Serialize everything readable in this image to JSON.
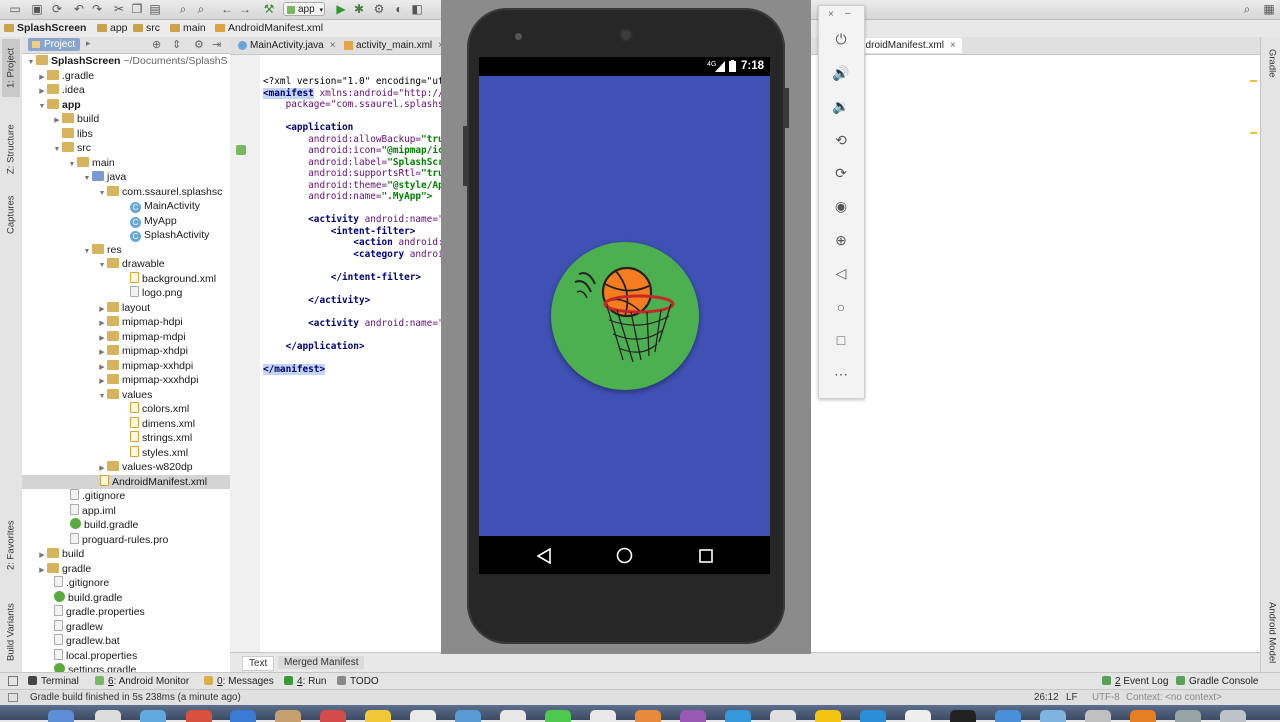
{
  "toolbar": {
    "run_config": "app"
  },
  "breadcrumb": [
    "SplashScreen",
    "app",
    "src",
    "main",
    "AndroidManifest.xml"
  ],
  "left_stripe": {
    "project": "1: Project",
    "structure": "Z: Structure",
    "captures": "Captures",
    "favorites": "2: Favorites",
    "build_variants": "Build Variants"
  },
  "right_stripe": {
    "gradle": "Gradle",
    "android_model": "Android Model"
  },
  "project_panel": {
    "tab": "Project",
    "root_name": "SplashScreen",
    "root_path": "~/Documents/SplashS",
    "items": [
      ".gradle",
      ".idea",
      "app",
      "build",
      "libs",
      "src",
      "main",
      "java",
      "com.ssaurel.splashsc",
      "MainActivity",
      "MyApp",
      "SplashActivity",
      "res",
      "drawable",
      "background.xml",
      "logo.png",
      "layout",
      "mipmap-hdpi",
      "mipmap-mdpi",
      "mipmap-xhdpi",
      "mipmap-xxhdpi",
      "mipmap-xxxhdpi",
      "values",
      "colors.xml",
      "dimens.xml",
      "strings.xml",
      "styles.xml",
      "values-w820dp",
      "AndroidManifest.xml",
      ".gitignore",
      "app.iml",
      "build.gradle",
      "proguard-rules.pro",
      "build",
      "gradle",
      ".gitignore",
      "build.gradle",
      "gradle.properties",
      "gradlew",
      "gradlew.bat",
      "local.properties",
      "settings.gradle"
    ]
  },
  "editor_tabs": {
    "tab1": "MainActivity.java",
    "tab2": "activity_main.xml",
    "tab3": "ndroidManifest.xml"
  },
  "code": {
    "l1a": "<?xml version=\"1.0\" encoding=\"utf-",
    "l2a": "<manifest",
    "l2b": " xmlns:android=\"http://sc",
    "l3": "    package=\"com.ssaurel.splashsc",
    "l5": "    <application",
    "l6a": "        android:allowBackup=",
    "l6b": "\"true",
    "l7a": "        android:icon=",
    "l7b": "\"@mipmap/ic_",
    "l8a": "        android:label=",
    "l8b": "\"SplashScree",
    "l9a": "        android:supportsRtl=",
    "l9b": "\"true",
    "l10a": "        android:theme=",
    "l10b": "\"@style/App",
    "l11a": "        android:name=",
    "l11b": "\".MyApp\">",
    "l13a": "        <activity",
    "l13b": " android:name=\".",
    "l14": "            <intent-filter>",
    "l15a": "                <action",
    "l15b": " android:na",
    "l16a": "                <category",
    "l16b": " android",
    "l18": "            </intent-filter>",
    "l20": "        </activity>",
    "l22a": "        <activity",
    "l22b": " android:name=\".",
    "l24": "    </application>",
    "l26": "</manifest>"
  },
  "bottom_tabs": {
    "text": "Text",
    "merged": "Merged Manifest"
  },
  "tool_windows": {
    "terminal": "Terminal",
    "monitor_num": "6",
    "monitor": ": Android Monitor",
    "messages_num": "0",
    "messages": ": Messages",
    "run_num": "4",
    "run": ": Run",
    "todo": "TODO",
    "event_log_num": "2",
    "event_log": " Event Log",
    "gradle_console": "Gradle Console"
  },
  "status_bar": {
    "message": "Gradle build finished in 5s 238ms (a minute ago)",
    "position": "26:12",
    "line_sep": "LF",
    "encoding": "UTF-8",
    "context": "Context: <no context>"
  },
  "emulator": {
    "clock": "7:18",
    "network": "4G"
  },
  "colors": {
    "app_background": "#3f51b5",
    "logo_circle": "#4caf50",
    "ball": "#f57c1f"
  }
}
